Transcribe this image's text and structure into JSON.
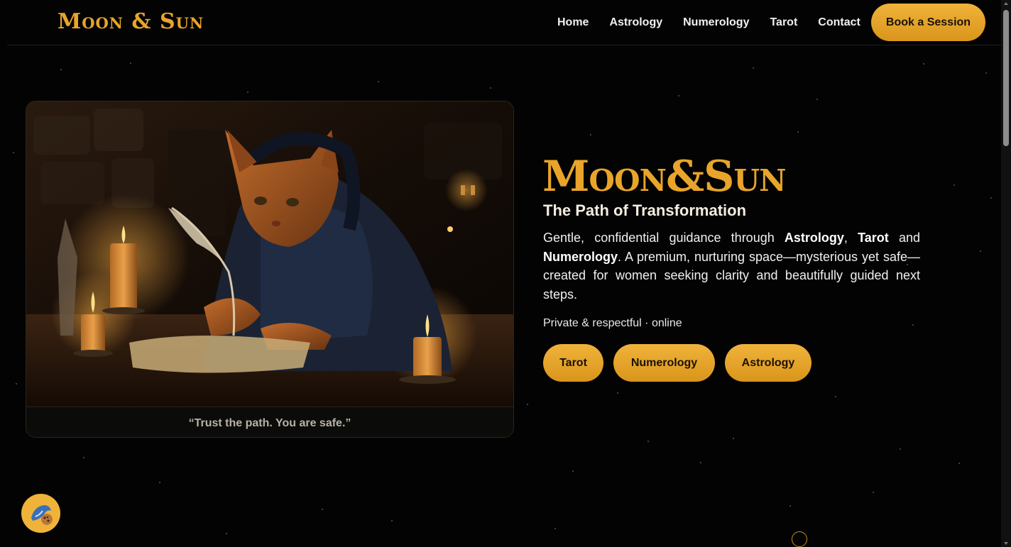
{
  "header": {
    "logo": "Moon & Sun",
    "nav": [
      "Home",
      "Astrology",
      "Numerology",
      "Tarot",
      "Contact"
    ],
    "cta_label": "Book a Session"
  },
  "hero": {
    "image_icon": "hooded-cat-writing-by-candlelight-image",
    "quote": "“Trust the path. You are safe.”",
    "title": "Moon&Sun",
    "subtitle": "The Path of Transformation",
    "description": {
      "p1": "Gentle, confidential guidance through ",
      "b1": "Astrology",
      "p2": ", ",
      "b2": "Tarot",
      "p3": " and ",
      "b3": "Numerology",
      "p4": ". A premium, nurturing space—mysterious yet safe—created for women seeking clarity and beautifully guided next steps."
    },
    "note": "Private & respectful · online",
    "pills": [
      "Tarot",
      "Numerology",
      "Astrology"
    ]
  },
  "widgets": {
    "cookie_icon": "cookie-mascot-icon"
  },
  "colors": {
    "accent": "#e8a52a",
    "background": "#030303"
  }
}
